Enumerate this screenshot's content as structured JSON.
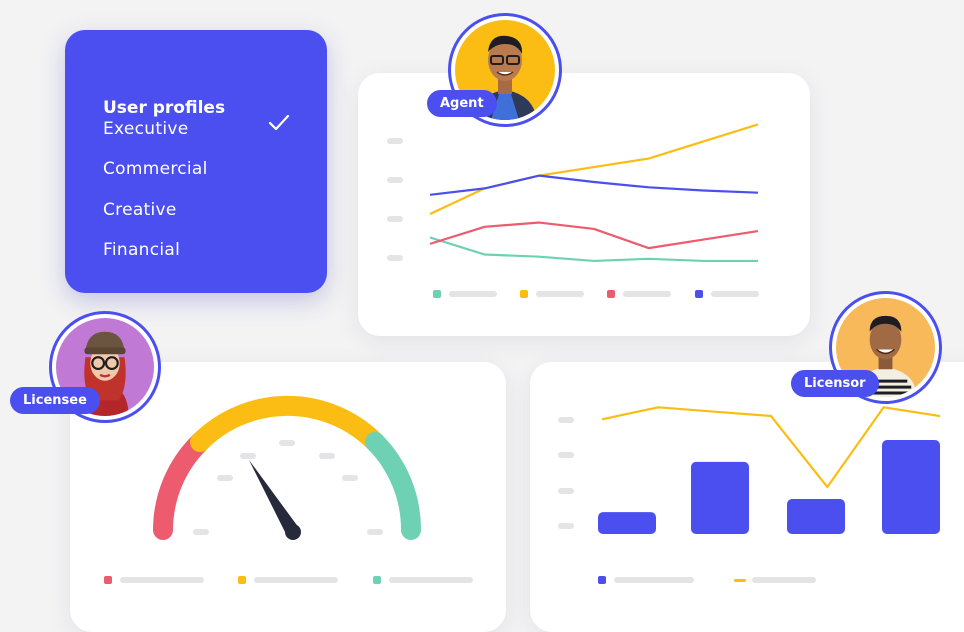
{
  "profiles": {
    "title": "User profiles",
    "items": [
      {
        "label": "Executive",
        "selected": true
      },
      {
        "label": "Commercial",
        "selected": false
      },
      {
        "label": "Creative",
        "selected": false
      },
      {
        "label": "Financial",
        "selected": false
      }
    ]
  },
  "avatars": {
    "agent": {
      "label": "Agent"
    },
    "licensee": {
      "label": "Licensee"
    },
    "licensor": {
      "label": "Licensor"
    }
  },
  "colors": {
    "accent": "#4b4ff0",
    "green": "#6fd1b4",
    "yellow": "#fbbd14",
    "red": "#ec5b6e",
    "blue": "#4b4ff0",
    "placeholder": "#e4e4e6",
    "needle": "#262a3a"
  },
  "chart_data": [
    {
      "type": "line",
      "x": [
        1,
        2,
        3,
        4,
        5,
        6,
        7
      ],
      "series": [
        {
          "color": "green",
          "values": [
            38,
            22,
            20,
            16,
            18,
            16,
            16
          ]
        },
        {
          "color": "yellow",
          "values": [
            60,
            84,
            96,
            104,
            112,
            128,
            144
          ]
        },
        {
          "color": "red",
          "values": [
            32,
            48,
            52,
            46,
            28,
            36,
            44
          ]
        },
        {
          "color": "blue",
          "values": [
            78,
            84,
            96,
            90,
            85,
            82,
            80
          ]
        }
      ],
      "ylim": [
        0,
        150
      ],
      "grid": false,
      "legend": "bottom"
    },
    {
      "type": "gauge",
      "segments": [
        {
          "color": "red",
          "fraction": 0.25
        },
        {
          "color": "yellow",
          "fraction": 0.5
        },
        {
          "color": "green",
          "fraction": 0.25
        }
      ],
      "needle_fraction": 0.37,
      "legend": "bottom"
    },
    {
      "type": "bar",
      "categories": [
        "1",
        "2",
        "3",
        "4"
      ],
      "series": [
        {
          "color": "blue",
          "type": "bar",
          "values": [
            20,
            66,
            32,
            86
          ]
        },
        {
          "color": "yellow",
          "type": "line",
          "x": [
            1,
            2,
            3,
            4,
            5,
            6,
            7
          ],
          "values": [
            105,
            116,
            112,
            108,
            43,
            116,
            108
          ]
        }
      ],
      "ylim": [
        0,
        130
      ],
      "grid": false,
      "legend": "bottom"
    }
  ]
}
